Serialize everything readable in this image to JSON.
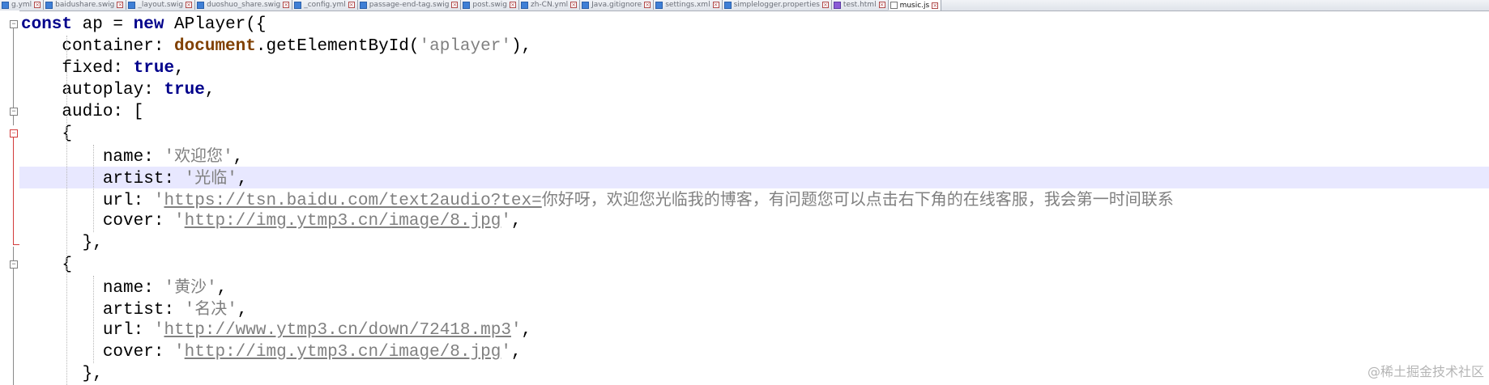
{
  "tabs": [
    {
      "label": "g.yml",
      "type": "yml",
      "active": false
    },
    {
      "label": "baidushare.swig",
      "type": "swig",
      "active": false
    },
    {
      "label": "_layout.swig",
      "type": "swig",
      "active": false
    },
    {
      "label": "duoshuo_share.swig",
      "type": "swig",
      "active": false
    },
    {
      "label": "_config.yml",
      "type": "yml",
      "active": false
    },
    {
      "label": "passage-end-tag.swig",
      "type": "swig",
      "active": false
    },
    {
      "label": "post.swig",
      "type": "swig",
      "active": false
    },
    {
      "label": "zh-CN.yml",
      "type": "yml",
      "active": false
    },
    {
      "label": "Java.gitignore",
      "type": "txt",
      "active": false
    },
    {
      "label": "settings.xml",
      "type": "xml",
      "active": false
    },
    {
      "label": "simplelogger.properties",
      "type": "txt",
      "active": false
    },
    {
      "label": "test.html",
      "type": "html",
      "active": false
    },
    {
      "label": "music.js",
      "type": "js",
      "active": true
    }
  ],
  "code": {
    "l1": {
      "kw1": "const",
      "t1": " ap = ",
      "kw2": "new",
      "t2": " APlayer({"
    },
    "l2": {
      "t1": "container: ",
      "obj": "document",
      "t2": ".getElementById(",
      "s1": "'aplayer'",
      "t3": "),"
    },
    "l3": {
      "t1": "fixed: ",
      "kw": "true",
      "t2": ","
    },
    "l4": {
      "t1": "autoplay: ",
      "kw": "true",
      "t2": ","
    },
    "l5": {
      "t1": "audio: ["
    },
    "l6": {
      "t1": "{"
    },
    "l7": {
      "t1": "name: ",
      "q1": "'",
      "cjk": "欢迎您",
      "q2": "'",
      "t2": ","
    },
    "l8": {
      "t1": "artist: ",
      "q1": "'",
      "cjk": "光临",
      "q2": "'",
      "t2": ","
    },
    "l9": {
      "t1": "url: ",
      "q1": "'",
      "url": "https://tsn.baidu.com/text2audio?tex=",
      "cjk": "你好呀，欢迎您光临我的博客，有问题您可以点击右下角的在线客服，我会第一时间联系"
    },
    "l10": {
      "t1": "cover: ",
      "q1": "'",
      "url": "http://img.ytmp3.cn/image/8.jpg",
      "q2": "'",
      "t2": ","
    },
    "l11": {
      "t1": "},"
    },
    "l12": {
      "t1": "{"
    },
    "l13": {
      "t1": "name: ",
      "q1": "'",
      "cjk": "黄沙",
      "q2": "'",
      "t2": ","
    },
    "l14": {
      "t1": "artist: ",
      "q1": "'",
      "cjk": "名决",
      "q2": "'",
      "t2": ","
    },
    "l15": {
      "t1": "url: ",
      "q1": "'",
      "url": "http://www.ytmp3.cn/down/72418.mp3",
      "q2": "'",
      "t2": ","
    },
    "l16": {
      "t1": "cover: ",
      "q1": "'",
      "url": "http://img.ytmp3.cn/image/8.jpg",
      "q2": "'",
      "t2": ","
    },
    "l17": {
      "t1": "},"
    }
  },
  "watermark": "@稀土掘金技术社区",
  "colors": {
    "keyword": "#00008b",
    "object": "#804000",
    "string": "#808080",
    "current_line": "#e8e8ff",
    "fold_active": "#d23c3c"
  }
}
